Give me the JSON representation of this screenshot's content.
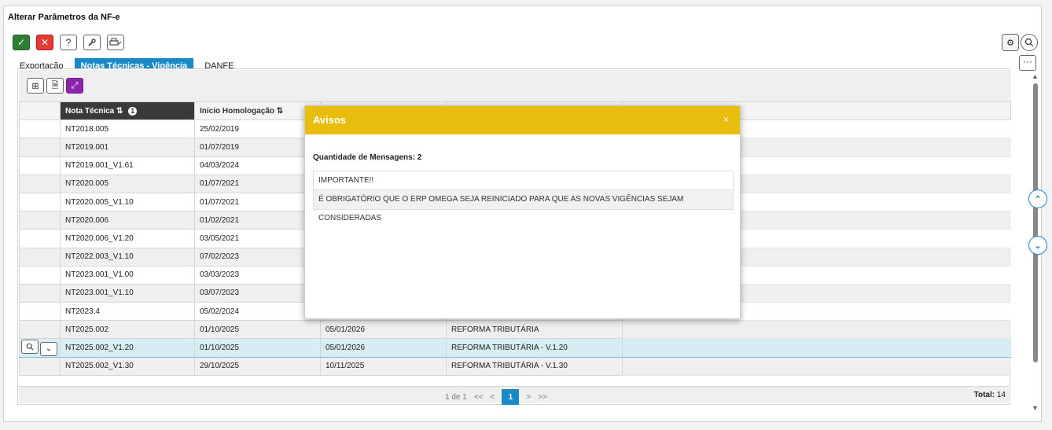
{
  "window": {
    "title": "Alterar Parâmetros da NF-e"
  },
  "toolbar": {
    "confirm_icon": "check-icon",
    "cancel_icon": "close-icon",
    "help_label": "?",
    "tools_icon": "wrench-icon",
    "print_icon": "printer-icon"
  },
  "tabs": [
    {
      "label": "Exportação",
      "active": false
    },
    {
      "label": "Notas Técnicas - Vigência",
      "active": true
    },
    {
      "label": "DANFE",
      "active": false
    }
  ],
  "grid": {
    "columns": [
      {
        "label": ""
      },
      {
        "label": "Nota Técnica",
        "sort": "⇅",
        "badge": "1"
      },
      {
        "label": "Início Homologação",
        "sort": "⇅"
      },
      {
        "label": ""
      },
      {
        "label": ""
      },
      {
        "label": ""
      }
    ],
    "rows": [
      {
        "nota": "NT2018.005",
        "inicio": "25/02/2019",
        "c3": "",
        "c4": ""
      },
      {
        "nota": "NT2019.001",
        "inicio": "01/07/2019",
        "c3": "",
        "c4": ""
      },
      {
        "nota": "NT2019.001_V1.61",
        "inicio": "04/03/2024",
        "c3": "",
        "c4": ""
      },
      {
        "nota": "NT2020.005",
        "inicio": "01/07/2021",
        "c3": "",
        "c4": ""
      },
      {
        "nota": "NT2020.005_V1.10",
        "inicio": "01/07/2021",
        "c3": "",
        "c4": ""
      },
      {
        "nota": "NT2020.006",
        "inicio": "01/02/2021",
        "c3": "",
        "c4": ""
      },
      {
        "nota": "NT2020.006_V1.20",
        "inicio": "03/05/2021",
        "c3": "",
        "c4": ""
      },
      {
        "nota": "NT2022.003_V1.10",
        "inicio": "07/02/2023",
        "c3": "",
        "c4": ""
      },
      {
        "nota": "NT2023.001_V1.00",
        "inicio": "03/03/2023",
        "c3": "",
        "c4": ""
      },
      {
        "nota": "NT2023.001_V1.10",
        "inicio": "03/07/2023",
        "c3": "",
        "c4": ""
      },
      {
        "nota": "NT2023.4",
        "inicio": "05/02/2024",
        "c3": "",
        "c4": ""
      },
      {
        "nota": "NT2025.002",
        "inicio": "01/10/2025",
        "c3": "05/01/2026",
        "c4": "REFORMA TRIBUTÁRIA"
      },
      {
        "nota": "NT2025.002_V1.20",
        "inicio": "01/10/2025",
        "c3": "05/01/2026",
        "c4": "REFORMA TRIBUTÁRIA - V.1.20",
        "selected": true
      },
      {
        "nota": "NT2025.002_V1.30",
        "inicio": "29/10/2025",
        "c3": "10/11/2025",
        "c4": "REFORMA TRIBUTÁRIA - V.1.30"
      }
    ]
  },
  "pager": {
    "info": "1 de 1",
    "first": "<<",
    "prev": "<",
    "current": "1",
    "next": ">",
    "last": ">>",
    "total_label": "Total:",
    "total_value": "14"
  },
  "modal": {
    "title": "Avisos",
    "close": "×",
    "count_label": "Quantidade de Mensagens: 2",
    "messages": [
      "IMPORTANTE!!",
      "É OBRIGATÓRIO QUE O ERP OMEGA SEJA REINICIADO PARA QUE AS NOVAS VIGÊNCIAS SEJAM CONSIDERADAS"
    ]
  },
  "colors": {
    "accent": "#1a8ac6",
    "modal_header": "#e8bd0c",
    "confirm": "#2f7d32",
    "cancel": "#e53935",
    "export_button": "#8e24aa"
  }
}
